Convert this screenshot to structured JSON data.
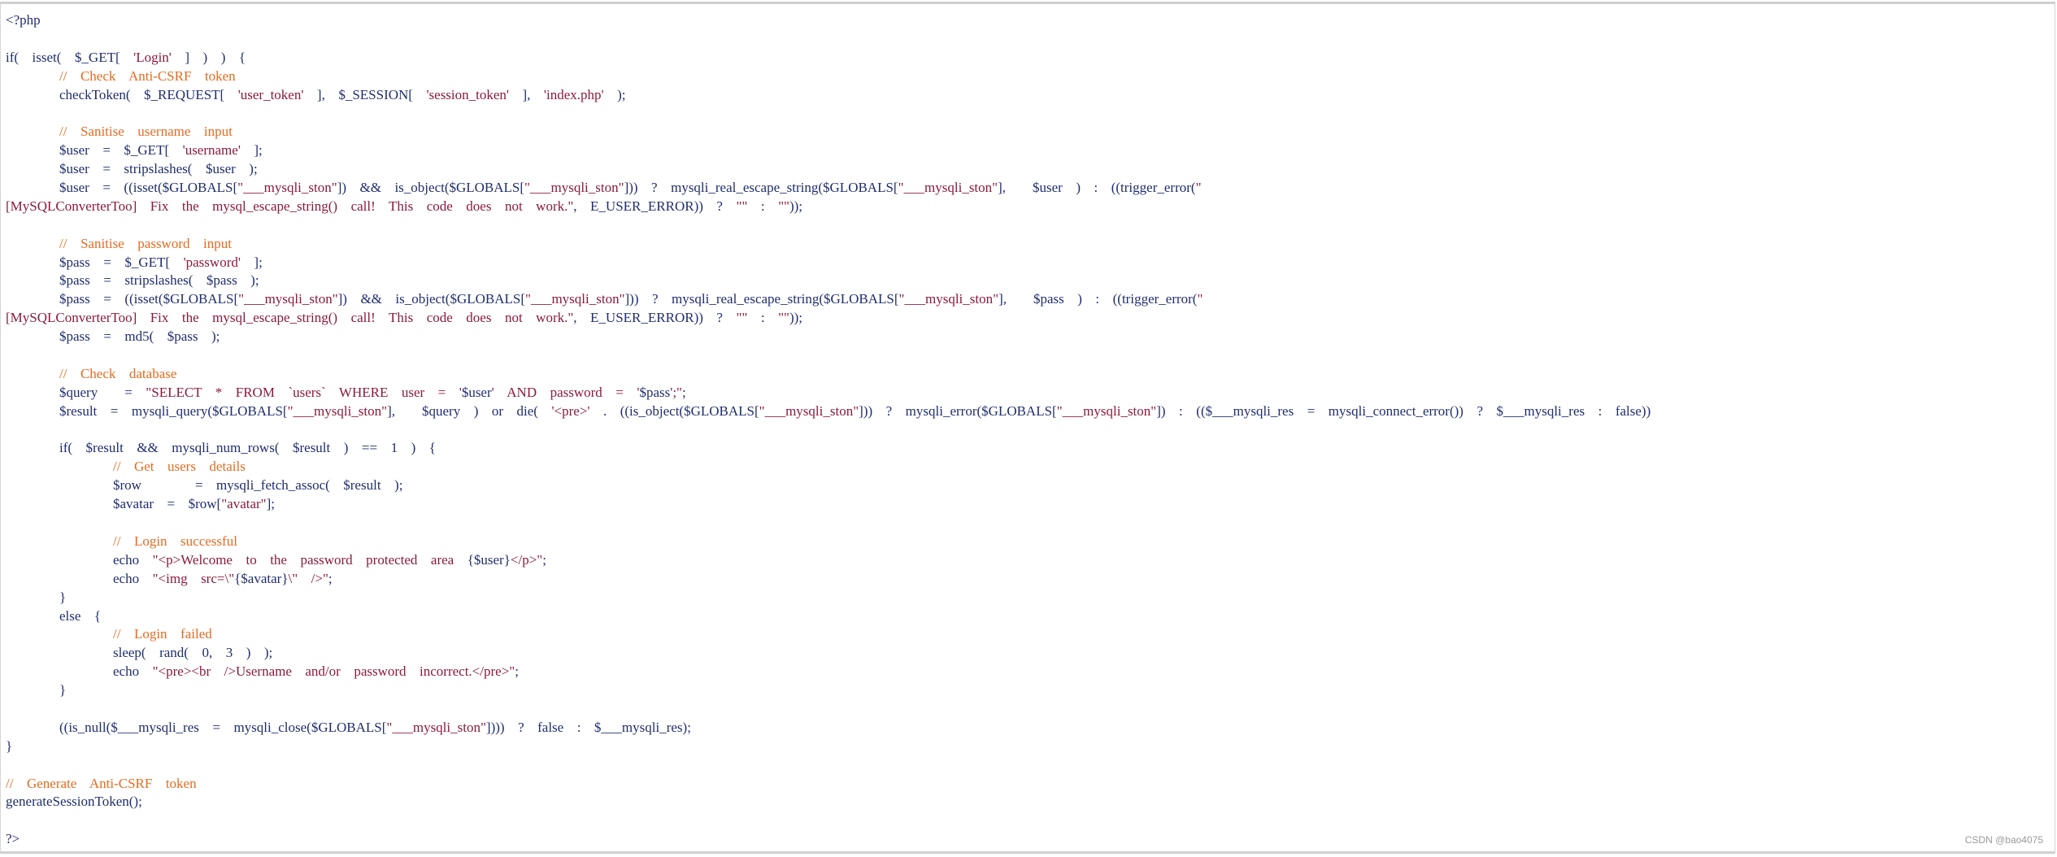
{
  "theme": {
    "keyword_color": "#1f2d6e",
    "comment_color": "#e86a1f",
    "string_color": "#8b1a3c"
  },
  "code_lines": [
    [
      {
        "t": "<?php",
        "k": "p"
      }
    ],
    [],
    [
      {
        "t": "if(  isset(  $_GET[  ",
        "k": "p"
      },
      {
        "t": "'Login'",
        "k": "s"
      },
      {
        "t": "  ]  )  )  {",
        "k": "p"
      }
    ],
    [
      {
        "t": "        ",
        "k": "p"
      },
      {
        "t": "//  Check  Anti-CSRF  token",
        "k": "c"
      }
    ],
    [
      {
        "t": "        checkToken(  $_REQUEST[  ",
        "k": "p"
      },
      {
        "t": "'user_token'",
        "k": "s"
      },
      {
        "t": "  ],  $_SESSION[  ",
        "k": "p"
      },
      {
        "t": "'session_token'",
        "k": "s"
      },
      {
        "t": "  ],  ",
        "k": "p"
      },
      {
        "t": "'index.php'",
        "k": "s"
      },
      {
        "t": "  );",
        "k": "p"
      }
    ],
    [],
    [
      {
        "t": "        ",
        "k": "p"
      },
      {
        "t": "//  Sanitise  username  input",
        "k": "c"
      }
    ],
    [
      {
        "t": "        $user  =  $_GET[  ",
        "k": "p"
      },
      {
        "t": "'username'",
        "k": "s"
      },
      {
        "t": "  ];",
        "k": "p"
      }
    ],
    [
      {
        "t": "        $user  =  stripslashes(  $user  );",
        "k": "p"
      }
    ],
    [
      {
        "t": "        $user  =  ((isset($GLOBALS[",
        "k": "p"
      },
      {
        "t": "\"___mysqli_ston\"",
        "k": "s"
      },
      {
        "t": "])  &&  is_object($GLOBALS[",
        "k": "p"
      },
      {
        "t": "\"___mysqli_ston\"",
        "k": "s"
      },
      {
        "t": "]))  ?  mysqli_real_escape_string($GLOBALS[",
        "k": "p"
      },
      {
        "t": "\"___mysqli_ston\"",
        "k": "s"
      },
      {
        "t": "],    $user  )  :  ((trigger_error(",
        "k": "p"
      },
      {
        "t": "\"",
        "k": "s"
      }
    ],
    [
      {
        "t": "[MySQLConverterToo]  Fix  the  mysql_escape_string()  call!  This  code  does  not  work.\"",
        "k": "s"
      },
      {
        "t": ",  E_USER_ERROR))  ?  ",
        "k": "p"
      },
      {
        "t": "\"\"",
        "k": "s"
      },
      {
        "t": "  :  ",
        "k": "p"
      },
      {
        "t": "\"\"",
        "k": "s"
      },
      {
        "t": "));",
        "k": "p"
      }
    ],
    [],
    [
      {
        "t": "        ",
        "k": "p"
      },
      {
        "t": "//  Sanitise  password  input",
        "k": "c"
      }
    ],
    [
      {
        "t": "        $pass  =  $_GET[  ",
        "k": "p"
      },
      {
        "t": "'password'",
        "k": "s"
      },
      {
        "t": "  ];",
        "k": "p"
      }
    ],
    [
      {
        "t": "        $pass  =  stripslashes(  $pass  );",
        "k": "p"
      }
    ],
    [
      {
        "t": "        $pass  =  ((isset($GLOBALS[",
        "k": "p"
      },
      {
        "t": "\"___mysqli_ston\"",
        "k": "s"
      },
      {
        "t": "])  &&  is_object($GLOBALS[",
        "k": "p"
      },
      {
        "t": "\"___mysqli_ston\"",
        "k": "s"
      },
      {
        "t": "]))  ?  mysqli_real_escape_string($GLOBALS[",
        "k": "p"
      },
      {
        "t": "\"___mysqli_ston\"",
        "k": "s"
      },
      {
        "t": "],    $pass  )  :  ((trigger_error(",
        "k": "p"
      },
      {
        "t": "\"",
        "k": "s"
      }
    ],
    [
      {
        "t": "[MySQLConverterToo]  Fix  the  mysql_escape_string()  call!  This  code  does  not  work.\"",
        "k": "s"
      },
      {
        "t": ",  E_USER_ERROR))  ?  ",
        "k": "p"
      },
      {
        "t": "\"\"",
        "k": "s"
      },
      {
        "t": "  :  ",
        "k": "p"
      },
      {
        "t": "\"\"",
        "k": "s"
      },
      {
        "t": "));",
        "k": "p"
      }
    ],
    [
      {
        "t": "        $pass  =  md5(  $pass  );",
        "k": "p"
      }
    ],
    [],
    [
      {
        "t": "        ",
        "k": "p"
      },
      {
        "t": "//  Check  database",
        "k": "c"
      }
    ],
    [
      {
        "t": "        $query    =  ",
        "k": "p"
      },
      {
        "t": "\"SELECT  *  FROM  `users`  WHERE  user  =  '",
        "k": "s"
      },
      {
        "t": "$user",
        "k": "p"
      },
      {
        "t": "'  AND  password  =  '",
        "k": "s"
      },
      {
        "t": "$pass",
        "k": "p"
      },
      {
        "t": "';\"",
        "k": "s"
      },
      {
        "t": ";",
        "k": "p"
      }
    ],
    [
      {
        "t": "        $result  =  mysqli_query($GLOBALS[",
        "k": "p"
      },
      {
        "t": "\"___mysqli_ston\"",
        "k": "s"
      },
      {
        "t": "],    $query  )  or  die(  ",
        "k": "p"
      },
      {
        "t": "'<pre>'",
        "k": "s"
      },
      {
        "t": "  .  ((is_object($GLOBALS[",
        "k": "p"
      },
      {
        "t": "\"___mysqli_ston\"",
        "k": "s"
      },
      {
        "t": "]))  ?  mysqli_error($GLOBALS[",
        "k": "p"
      },
      {
        "t": "\"___mysqli_ston\"",
        "k": "s"
      },
      {
        "t": "])  :  (($___mysqli_res  =  mysqli_connect_error())  ?  $___mysqli_res  :  false))",
        "k": "p"
      }
    ],
    [],
    [
      {
        "t": "        if(  $result  &&  mysqli_num_rows(  $result  )  ==  1  )  {",
        "k": "p"
      }
    ],
    [
      {
        "t": "                ",
        "k": "p"
      },
      {
        "t": "//  Get  users  details",
        "k": "c"
      }
    ],
    [
      {
        "t": "                $row        =  mysqli_fetch_assoc(  $result  );",
        "k": "p"
      }
    ],
    [
      {
        "t": "                $avatar  =  $row[",
        "k": "p"
      },
      {
        "t": "\"avatar\"",
        "k": "s"
      },
      {
        "t": "];",
        "k": "p"
      }
    ],
    [],
    [
      {
        "t": "                ",
        "k": "p"
      },
      {
        "t": "//  Login  successful",
        "k": "c"
      }
    ],
    [
      {
        "t": "                echo  ",
        "k": "p"
      },
      {
        "t": "\"<p>Welcome  to  the  password  protected  area  ",
        "k": "s"
      },
      {
        "t": "{$user}",
        "k": "p"
      },
      {
        "t": "</p>\"",
        "k": "s"
      },
      {
        "t": ";",
        "k": "p"
      }
    ],
    [
      {
        "t": "                echo  ",
        "k": "p"
      },
      {
        "t": "\"<img  src=\\\"",
        "k": "s"
      },
      {
        "t": "{$avatar}",
        "k": "p"
      },
      {
        "t": "\\\"  />\"",
        "k": "s"
      },
      {
        "t": ";",
        "k": "p"
      }
    ],
    [
      {
        "t": "        }",
        "k": "p"
      }
    ],
    [
      {
        "t": "        else  {",
        "k": "p"
      }
    ],
    [
      {
        "t": "                ",
        "k": "p"
      },
      {
        "t": "//  Login  failed",
        "k": "c"
      }
    ],
    [
      {
        "t": "                sleep(  rand(  0,  3  )  );",
        "k": "p"
      }
    ],
    [
      {
        "t": "                echo  ",
        "k": "p"
      },
      {
        "t": "\"<pre><br  />Username  and/or  password  incorrect.</pre>\"",
        "k": "s"
      },
      {
        "t": ";",
        "k": "p"
      }
    ],
    [
      {
        "t": "        }",
        "k": "p"
      }
    ],
    [],
    [
      {
        "t": "        ((is_null($___mysqli_res  =  mysqli_close($GLOBALS[",
        "k": "p"
      },
      {
        "t": "\"___mysqli_ston\"",
        "k": "s"
      },
      {
        "t": "])))  ?  false  :  $___mysqli_res);",
        "k": "p"
      }
    ],
    [
      {
        "t": "}",
        "k": "p"
      }
    ],
    [],
    [
      {
        "t": "//  Generate  Anti-CSRF  token",
        "k": "c"
      }
    ],
    [
      {
        "t": "generateSessionToken();",
        "k": "p"
      }
    ],
    [],
    [
      {
        "t": "?>",
        "k": "p"
      }
    ]
  ],
  "watermark": "CSDN @bao4075"
}
